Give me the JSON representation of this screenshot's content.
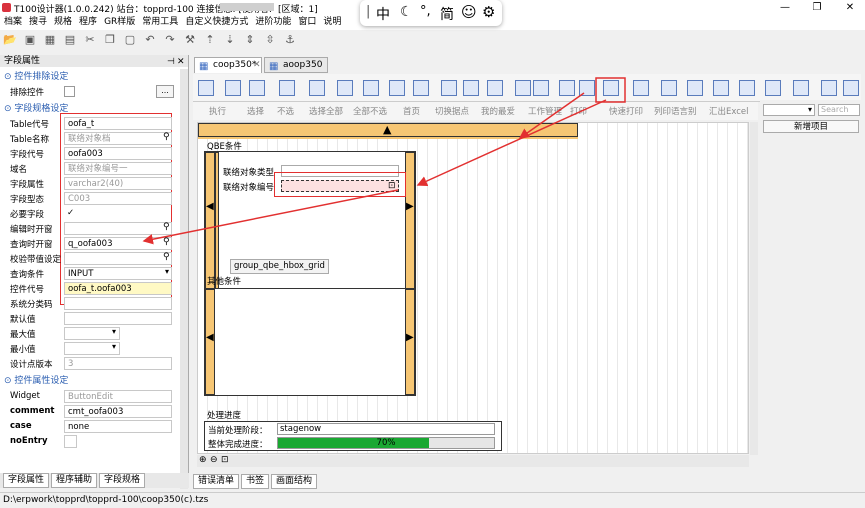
{
  "window": {
    "title": "T100设计器(1.0.0.242) 站台：topprd-100 连接信息: [使用者:",
    "area": "[区域：1]"
  },
  "menu": [
    "档案",
    "搜寻",
    "规格",
    "程序",
    "GR样版",
    "常用工具",
    "自定义快捷方式",
    "进阶功能",
    "窗口",
    "说明"
  ],
  "ime": {
    "chinese": "中",
    "punct": "°,",
    "simplified": "简"
  },
  "left_panel": {
    "title": "字段属性",
    "sections": {
      "exclude": "控件排除设定",
      "spec": "字段规格设定",
      "attr": "控件属性设定"
    },
    "exclude_label": "排除控件",
    "rows": [
      {
        "label": "Table代号",
        "value": "oofa_t"
      },
      {
        "label": "Table名称",
        "value": "联络对象档"
      },
      {
        "label": "字段代号",
        "value": "oofa003"
      },
      {
        "label": "域名",
        "value": "联络对象编号一"
      },
      {
        "label": "字段属性",
        "value": "varchar2(40)"
      },
      {
        "label": "字段型态",
        "value": "C003"
      },
      {
        "label": "必要字段",
        "value": "✓"
      },
      {
        "label": "编辑时开窗",
        "value": ""
      },
      {
        "label": "查询时开窗",
        "value": "q_oofa003"
      },
      {
        "label": "校验带值设定",
        "value": ""
      },
      {
        "label": "查询条件",
        "value": "INPUT"
      },
      {
        "label": "控件代号",
        "value": "oofa_t.oofa003"
      },
      {
        "label": "系统分类码",
        "value": ""
      },
      {
        "label": "默认值",
        "value": ""
      },
      {
        "label": "最大值",
        "value": ""
      },
      {
        "label": "最小值",
        "value": ""
      },
      {
        "label": "设计点版本",
        "value": "3"
      }
    ],
    "attr_rows": [
      {
        "label": "Widget",
        "value": "ButtonEdit"
      },
      {
        "label": "comment",
        "value": "cmt_oofa003"
      },
      {
        "label": "case",
        "value": "none"
      },
      {
        "label": "noEntry",
        "value": ""
      }
    ],
    "bottom_tabs": [
      "字段属性",
      "程序辅助",
      "字段规格"
    ]
  },
  "doc_tabs": [
    {
      "label": "coop350*"
    },
    {
      "label": "aoop350"
    }
  ],
  "action_bar": [
    "执行",
    "选择",
    "不选",
    "选择全部",
    "全部不选",
    "首页",
    "切换据点",
    "我的最爱",
    "工作管理",
    "打印",
    "快速打印",
    "列印语言别",
    "汇出Excel"
  ],
  "canvas": {
    "qbe_title": "QBE条件",
    "field1_label": "联络对象类型",
    "field2_label": "联络对象编号",
    "hbox_tooltip": "group_qbe_hbox_grid",
    "other_title": "其他条件",
    "progress_title": "处理进度",
    "stage_label": "当前处理阶段：",
    "stage_value": "stagenow",
    "overall_label": "整体完成进度：",
    "progress": 70,
    "progress_text": "70%"
  },
  "right_panel": {
    "search_placeholder": "Search",
    "new_button": "新增项目"
  },
  "bottom_tabs": [
    "错误清单",
    "书签",
    "画面结构"
  ],
  "status": "D:\\erpwork\\topprd\\topprd-100\\coop350(c).tzs",
  "colors": {
    "highlight_red": "#e23030",
    "progress_green": "#1aa832",
    "accent_orange": "#f6c674"
  }
}
